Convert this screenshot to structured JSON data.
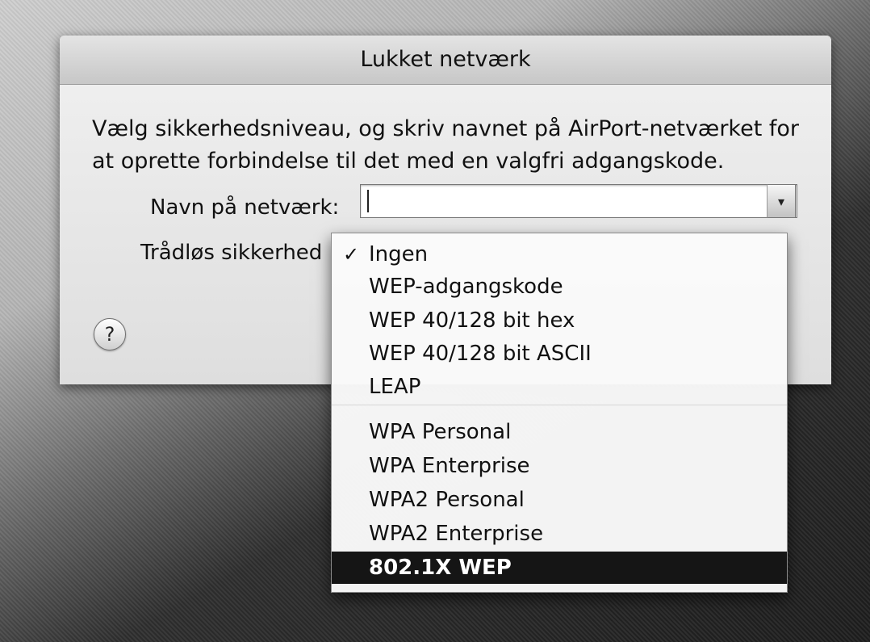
{
  "dialog": {
    "title": "Lukket netværk",
    "description": "Vælg sikkerhedsniveau, og skriv navnet på AirPort-netværket for at oprette forbindelse til det med en valgfri adgangskode.",
    "network_name_label": "Navn på netværk:",
    "network_name_value": "",
    "security_label": "Trådløs sikkerhed",
    "help_glyph": "?",
    "dropdown_arrow_glyph": "▾"
  },
  "security_menu": {
    "items": [
      {
        "label": "Ingen",
        "checked": true
      },
      {
        "label": "WEP-adgangskode"
      },
      {
        "label": "WEP 40/128 bit hex"
      },
      {
        "label": "WEP 40/128 bit ASCII"
      },
      {
        "label": "LEAP"
      },
      {
        "label": "WPA Personal"
      },
      {
        "label": "WPA Enterprise"
      },
      {
        "label": "WPA2 Personal"
      },
      {
        "label": "WPA2 Enterprise"
      },
      {
        "label": "802.1X WEP",
        "highlighted": true
      }
    ],
    "check_glyph": "✓"
  },
  "colors": {
    "highlight": "#151515",
    "sheet": "#e6e6e6"
  }
}
